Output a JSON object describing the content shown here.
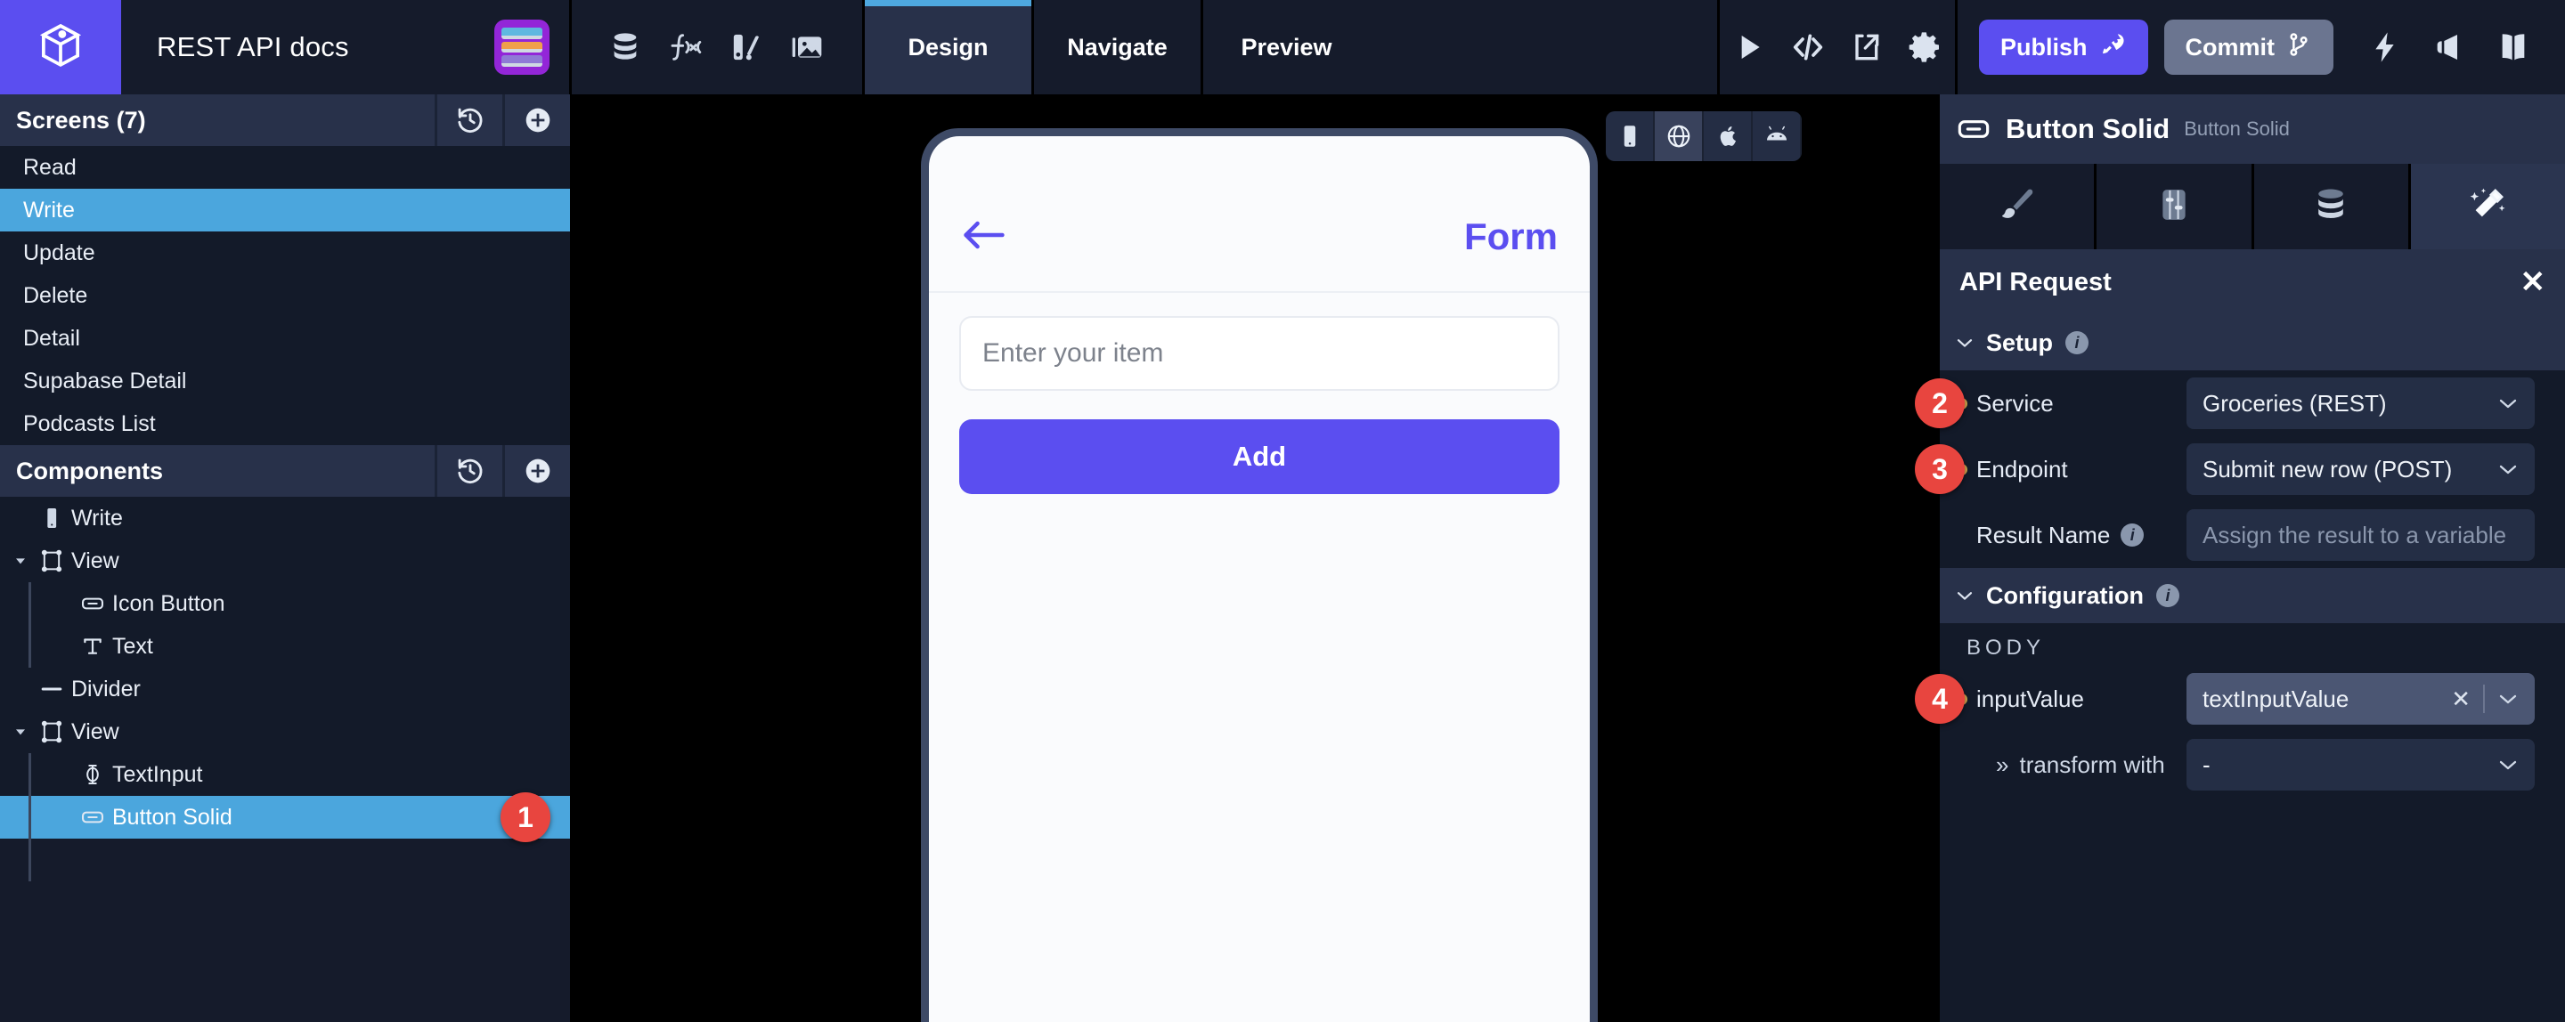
{
  "topbar": {
    "logo_icon": "cube-logo-icon",
    "project_title": "REST API docs",
    "project_thumb_icon": "books-thumbnail-icon",
    "tools": [
      {
        "name": "database-icon",
        "label": "Database"
      },
      {
        "name": "function-icon",
        "label": "f(x)"
      },
      {
        "name": "theme-icon",
        "label": "Theme"
      },
      {
        "name": "assets-image-icon",
        "label": "Assets"
      }
    ],
    "mode_tabs": [
      {
        "label": "Design",
        "active": true
      },
      {
        "label": "Navigate",
        "active": false
      },
      {
        "label": "Preview",
        "active": false
      }
    ],
    "right_tools": [
      {
        "name": "play-icon",
        "label": "Run"
      },
      {
        "name": "code-icon",
        "label": "Code"
      },
      {
        "name": "share-icon",
        "label": "Share"
      },
      {
        "name": "gear-icon",
        "label": "Settings"
      }
    ],
    "publish_label": "Publish",
    "publish_icon": "rocket-icon",
    "commit_label": "Commit",
    "commit_icon": "git-branch-icon",
    "far_tools": [
      {
        "name": "lightning-icon",
        "label": "Activity"
      },
      {
        "name": "megaphone-icon",
        "label": "Announcements"
      },
      {
        "name": "book-icon",
        "label": "Docs"
      }
    ],
    "accent_blue": "#4ea8e0",
    "brand_purple": "#5b4ef0"
  },
  "screens_panel": {
    "title": "Screens (7)",
    "history_icon": "history-icon",
    "add_icon": "plus-circle-icon",
    "items": [
      {
        "label": "Read",
        "selected": false
      },
      {
        "label": "Write",
        "selected": true
      },
      {
        "label": "Update",
        "selected": false
      },
      {
        "label": "Delete",
        "selected": false
      },
      {
        "label": "Detail",
        "selected": false
      },
      {
        "label": "Supabase Detail",
        "selected": false
      },
      {
        "label": "Podcasts List",
        "selected": false
      }
    ]
  },
  "components_panel": {
    "title": "Components",
    "history_icon": "history-icon",
    "add_icon": "plus-circle-icon",
    "items": [
      {
        "label": "Write",
        "icon": "mobile-screen-icon",
        "depth": 0,
        "twisty": "none",
        "selected": false
      },
      {
        "label": "View",
        "icon": "frame-icon",
        "depth": 0,
        "twisty": "open",
        "selected": false
      },
      {
        "label": "Icon Button",
        "icon": "button-icon",
        "depth": 1,
        "twisty": "none",
        "selected": false
      },
      {
        "label": "Text",
        "icon": "text-icon",
        "depth": 1,
        "twisty": "none",
        "selected": false
      },
      {
        "label": "Divider",
        "icon": "divider-icon",
        "depth": 0,
        "twisty": "none",
        "selected": false
      },
      {
        "label": "View",
        "icon": "frame-icon",
        "depth": 0,
        "twisty": "open",
        "selected": false
      },
      {
        "label": "TextInput",
        "icon": "text-input-icon",
        "depth": 1,
        "twisty": "none",
        "selected": false
      },
      {
        "label": "Button Solid",
        "icon": "button-icon",
        "depth": 1,
        "twisty": "none",
        "selected": true,
        "badge": "1"
      }
    ]
  },
  "canvas": {
    "device_buttons": [
      {
        "name": "mobile-device-icon",
        "label": "Mobile",
        "active": false
      },
      {
        "name": "web-globe-icon",
        "label": "Web",
        "active": true
      },
      {
        "name": "apple-icon",
        "label": "iOS",
        "active": false
      },
      {
        "name": "android-icon",
        "label": "Android",
        "active": false
      }
    ],
    "preview": {
      "back_icon": "arrow-left-icon",
      "title": "Form",
      "input_placeholder": "Enter your item",
      "button_label": "Add",
      "accent": "#5b4ef0"
    }
  },
  "inspector": {
    "component_icon": "button-icon",
    "component_name": "Button Solid",
    "component_type": "Button Solid",
    "tabs": [
      {
        "name": "style-brush-icon",
        "label": "Style",
        "active": false
      },
      {
        "name": "layout-sliders-icon",
        "label": "Layout",
        "active": false
      },
      {
        "name": "data-database-icon",
        "label": "Data",
        "active": false
      },
      {
        "name": "actions-wand-icon",
        "label": "Actions",
        "active": true
      }
    ],
    "panel_title": "API Request",
    "close_icon": "close-icon",
    "setup": {
      "heading": "Setup",
      "info_icon": "info-icon",
      "fields": [
        {
          "label": "Service",
          "value": "Groceries (REST)",
          "control": "select",
          "required": true,
          "badge": "2",
          "info": false
        },
        {
          "label": "Endpoint",
          "value": "Submit new row (POST)",
          "control": "select",
          "required": true,
          "badge": "3",
          "info": false
        },
        {
          "label": "Result Name",
          "value": "Assign the result to a variable",
          "control": "placeholder",
          "required": false,
          "badge": "",
          "info": true
        }
      ]
    },
    "configuration": {
      "heading": "Configuration",
      "info_icon": "info-icon",
      "body_label": "BODY",
      "fields": [
        {
          "label": "inputValue",
          "value": "textInputValue",
          "control": "bound",
          "required": true,
          "badge": "4",
          "indent": false,
          "clear_icon": "close-icon"
        },
        {
          "label": "transform with",
          "value": "-",
          "control": "select",
          "required": false,
          "badge": "",
          "indent": true,
          "prefix": "»"
        }
      ]
    }
  }
}
